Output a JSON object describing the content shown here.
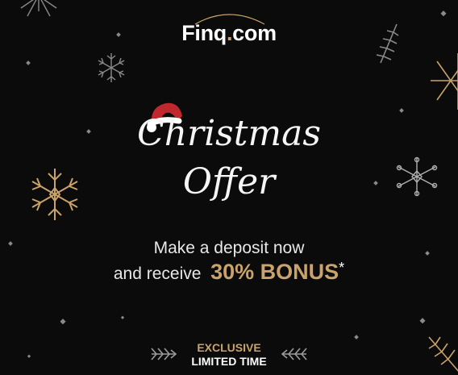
{
  "brand": {
    "name": "Finq",
    "dot": ".",
    "tld": "com"
  },
  "headline": {
    "line1": "Christmas",
    "line2": "Offer"
  },
  "message": {
    "line1": "Make a deposit now",
    "line2_prefix": "and receive",
    "bonus": "30% BONUS",
    "asterisk": "*"
  },
  "badge": {
    "line1": "EXCLUSIVE",
    "line2": "LIMITED TIME"
  },
  "colors": {
    "background": "#0b0b0b",
    "gold": "#c9a36a",
    "white": "#ffffff"
  }
}
